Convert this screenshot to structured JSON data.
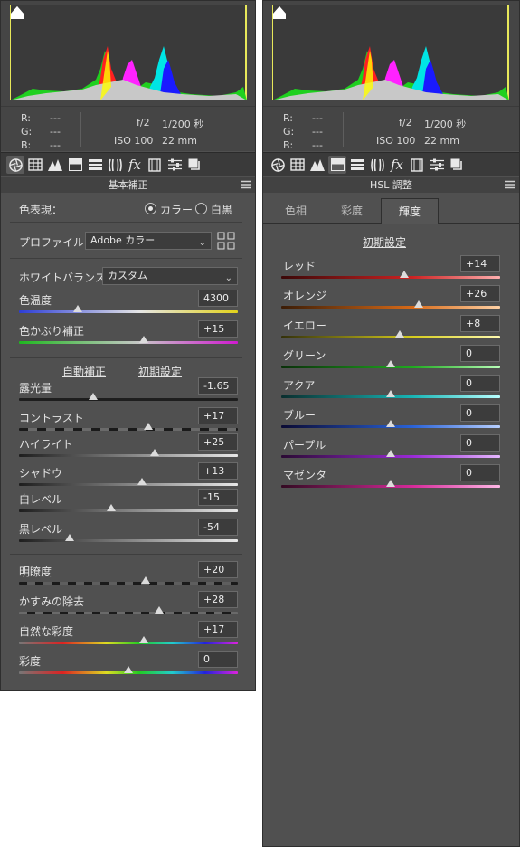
{
  "colors": {
    "panel_bg": "#505050",
    "histogram_bg": "#454545",
    "toolbar_bg": "#3a3a3a",
    "field_bg": "#3c3c3c"
  },
  "left": {
    "exif": {
      "r_label": "R:",
      "r_value": "---",
      "g_label": "G:",
      "g_value": "---",
      "b_label": "B:",
      "b_value": "---",
      "aperture": "f/2",
      "shutter": "1/200 秒",
      "iso": "ISO 100",
      "focal": "22 mm"
    },
    "toolbar_icons": [
      "aperture-icon",
      "grid-icon",
      "mountain-icon",
      "split-toning-icon",
      "hsl-icon",
      "lens-icon",
      "fx-icon",
      "filmstrip-icon",
      "sliders-icon",
      "presets-icon"
    ],
    "section_title": "基本補正",
    "treatment_label": "色表現：",
    "treatment_color": "カラー",
    "treatment_bw": "白黒",
    "profile_label": "プロファイル：",
    "profile_value": "Adobe カラー",
    "wb_label": "ホワイトバランス：",
    "wb_value": "カスタム",
    "auto_label": "自動補正",
    "default_label": "初期設定",
    "sliders": [
      {
        "label": "色温度",
        "value": "4300"
      },
      {
        "label": "色かぶり補正",
        "value": "+15"
      },
      {
        "label": "露光量",
        "value": "-1.65"
      },
      {
        "label": "コントラスト",
        "value": "+17"
      },
      {
        "label": "ハイライト",
        "value": "+25"
      },
      {
        "label": "シャドウ",
        "value": "+13"
      },
      {
        "label": "白レベル",
        "value": "-15"
      },
      {
        "label": "黒レベル",
        "value": "-54"
      },
      {
        "label": "明瞭度",
        "value": "+20"
      },
      {
        "label": "かすみの除去",
        "value": "+28"
      },
      {
        "label": "自然な彩度",
        "value": "+17"
      },
      {
        "label": "彩度",
        "value": "0"
      }
    ]
  },
  "right": {
    "exif": {
      "r_label": "R:",
      "r_value": "---",
      "g_label": "G:",
      "g_value": "---",
      "b_label": "B:",
      "b_value": "---",
      "aperture": "f/2",
      "shutter": "1/200 秒",
      "iso": "ISO 100",
      "focal": "22 mm"
    },
    "section_title": "HSL 調整",
    "tabs": [
      "色相",
      "彩度",
      "輝度"
    ],
    "default_label": "初期設定",
    "sliders": [
      {
        "label": "レッド",
        "value": "+14"
      },
      {
        "label": "オレンジ",
        "value": "+26"
      },
      {
        "label": "イエロー",
        "value": "+8"
      },
      {
        "label": "グリーン",
        "value": "0"
      },
      {
        "label": "アクア",
        "value": "0"
      },
      {
        "label": "ブルー",
        "value": "0"
      },
      {
        "label": "パープル",
        "value": "0"
      },
      {
        "label": "マゼンタ",
        "value": "0"
      }
    ]
  }
}
